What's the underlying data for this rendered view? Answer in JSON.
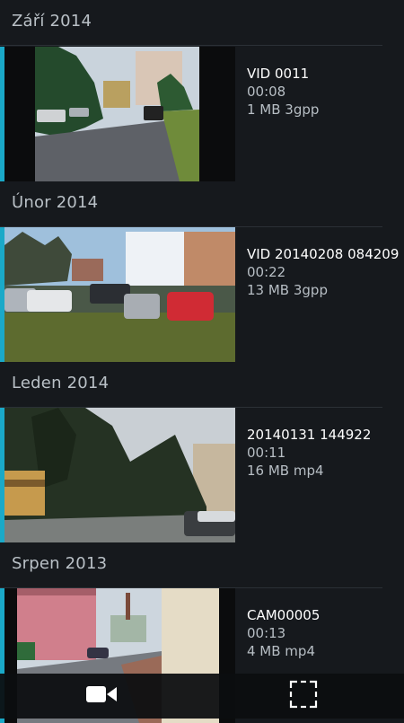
{
  "sections": [
    {
      "header": "Září 2014",
      "item": {
        "title": "VID 0011",
        "duration": "00:08",
        "size": "1 MB 3gpp"
      }
    },
    {
      "header": "Únor 2014",
      "item": {
        "title": "VID 20140208 084209",
        "duration": "00:22",
        "size": "13 MB 3gpp"
      }
    },
    {
      "header": "Leden 2014",
      "item": {
        "title": "20140131 144922",
        "duration": "00:11",
        "size": "16 MB mp4"
      }
    },
    {
      "header": "Srpen 2013",
      "item": {
        "title": "CAM00005",
        "duration": "00:13",
        "size": "4 MB mp4"
      }
    }
  ],
  "bottom_bar": {
    "left_icon": "video-camera-icon",
    "right_icon": "select-frame-icon"
  },
  "colors": {
    "accent": "#1aa9c8",
    "background": "#16191d"
  }
}
